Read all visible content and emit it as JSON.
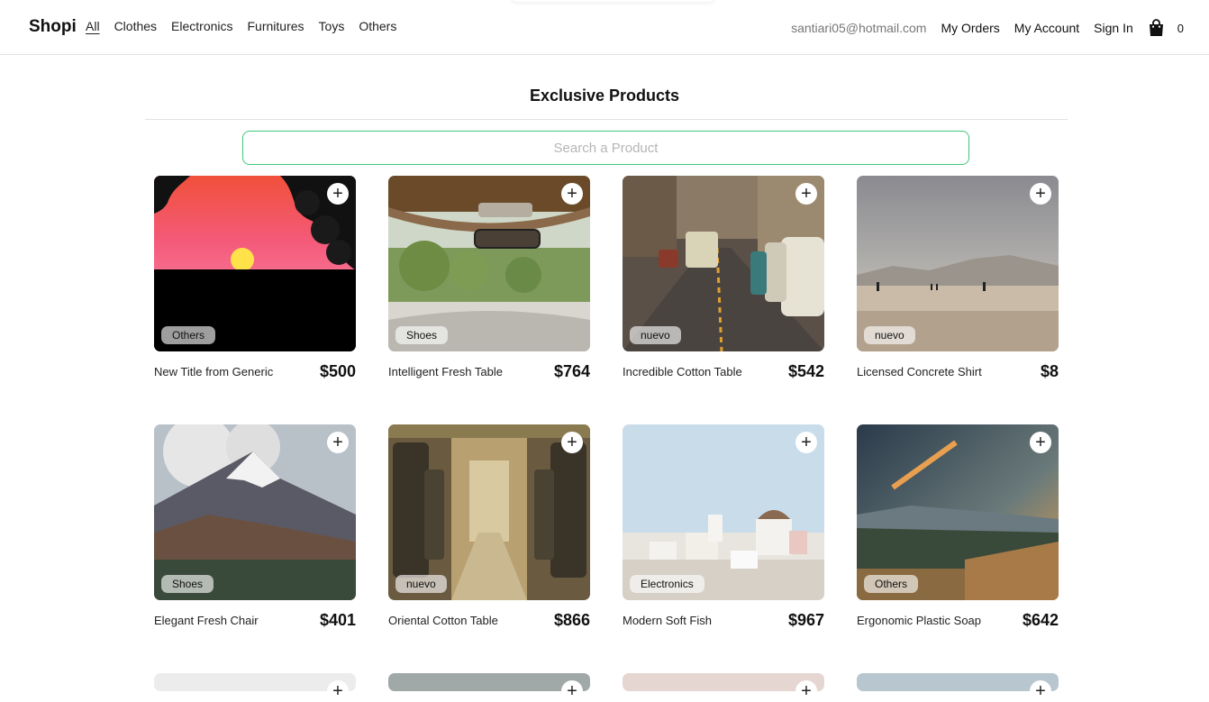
{
  "nav": {
    "brand": "Shopi",
    "categories": [
      "All",
      "Clothes",
      "Electronics",
      "Furnitures",
      "Toys",
      "Others"
    ],
    "email": "santiari05@hotmail.com",
    "my_orders": "My Orders",
    "my_account": "My Account",
    "sign_in": "Sign In",
    "cart_count": "0"
  },
  "page": {
    "title": "Exclusive Products",
    "search_placeholder": "Search a Product"
  },
  "add_label": "+",
  "products": [
    {
      "name": "New Title from Generic",
      "price": "$500",
      "category": "Others",
      "image": "sunset"
    },
    {
      "name": "Intelligent Fresh Table",
      "price": "$764",
      "category": "Shoes",
      "image": "car-interior"
    },
    {
      "name": "Incredible Cotton Table",
      "price": "$542",
      "category": "nuevo",
      "image": "city-street"
    },
    {
      "name": "Licensed Concrete Shirt",
      "price": "$8",
      "category": "nuevo",
      "image": "beach"
    },
    {
      "name": "Elegant Fresh Chair",
      "price": "$401",
      "category": "Shoes",
      "image": "mountain"
    },
    {
      "name": "Oriental Cotton Table",
      "price": "$866",
      "category": "nuevo",
      "image": "bus-interior"
    },
    {
      "name": "Modern Soft Fish",
      "price": "$967",
      "category": "Electronics",
      "image": "santorini"
    },
    {
      "name": "Ergonomic Plastic Soap",
      "price": "$642",
      "category": "Others",
      "image": "landscape"
    }
  ]
}
